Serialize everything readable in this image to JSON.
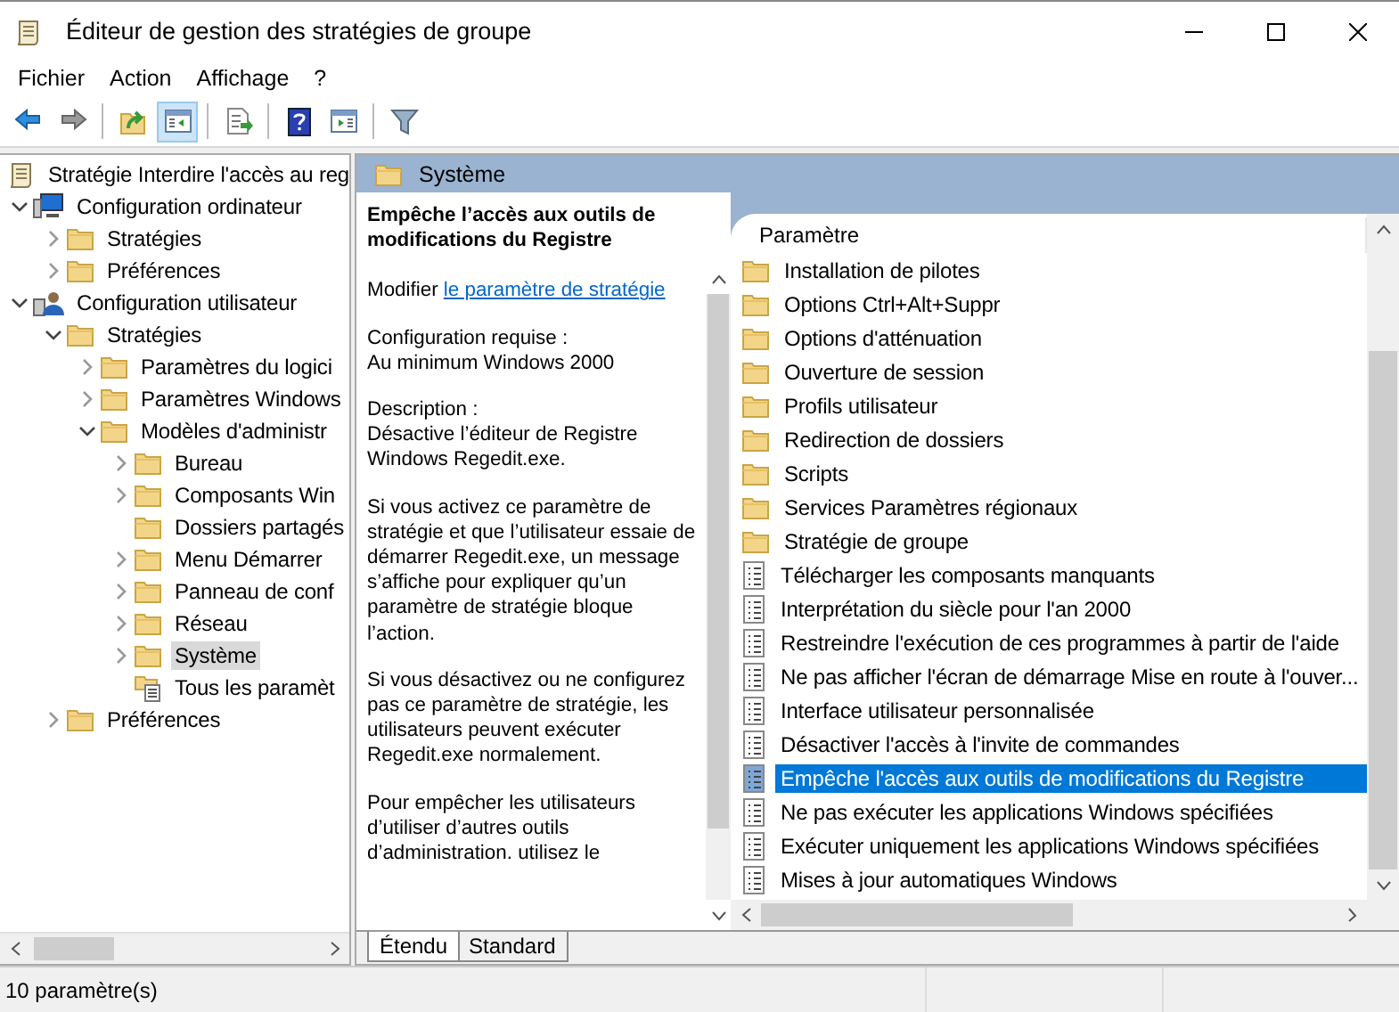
{
  "window": {
    "title": "Éditeur de gestion des stratégies de groupe"
  },
  "menu": [
    "Fichier",
    "Action",
    "Affichage",
    "?"
  ],
  "toolbar": [
    [
      {
        "kind": "back",
        "pressed": false
      },
      {
        "kind": "forward",
        "pressed": false
      }
    ],
    [
      {
        "kind": "up",
        "pressed": false
      },
      {
        "kind": "tree",
        "pressed": true
      }
    ],
    [
      {
        "kind": "export",
        "pressed": false
      }
    ],
    [
      {
        "kind": "help",
        "pressed": false
      },
      {
        "kind": "pane",
        "pressed": false
      }
    ],
    [
      {
        "kind": "filter",
        "pressed": false
      }
    ]
  ],
  "tree": [
    {
      "label": "Stratégie Interdire l'accès au reg",
      "kind": "policy",
      "selected": false,
      "children": [
        {
          "label": "Configuration ordinateur",
          "kind": "computer",
          "expanded": true,
          "selected": false,
          "children": [
            {
              "label": "Stratégies",
              "kind": "folder",
              "expanded": false,
              "selected": false
            },
            {
              "label": "Préférences",
              "kind": "folder",
              "expanded": false,
              "selected": false
            }
          ]
        },
        {
          "label": "Configuration utilisateur",
          "kind": "user",
          "expanded": true,
          "selected": false,
          "children": [
            {
              "label": "Stratégies",
              "kind": "folder",
              "expanded": true,
              "selected": false,
              "children": [
                {
                  "label": "Paramètres du logici",
                  "kind": "folder",
                  "expanded": false,
                  "selected": false
                },
                {
                  "label": "Paramètres Windows",
                  "kind": "folder",
                  "expanded": false,
                  "selected": false
                },
                {
                  "label": "Modèles d'administr",
                  "kind": "folder",
                  "expanded": true,
                  "selected": false,
                  "children": [
                    {
                      "label": "Bureau",
                      "kind": "folder",
                      "expanded": false,
                      "selected": false
                    },
                    {
                      "label": "Composants Win",
                      "kind": "folder",
                      "expanded": false,
                      "selected": false
                    },
                    {
                      "label": "Dossiers partagés",
                      "kind": "folder",
                      "selected": false
                    },
                    {
                      "label": "Menu Démarrer",
                      "kind": "folder",
                      "expanded": false,
                      "selected": false
                    },
                    {
                      "label": "Panneau de conf",
                      "kind": "folder",
                      "expanded": false,
                      "selected": false
                    },
                    {
                      "label": "Réseau",
                      "kind": "folder",
                      "expanded": false,
                      "selected": false
                    },
                    {
                      "label": "Système",
                      "kind": "folder",
                      "expanded": false,
                      "selected": true
                    },
                    {
                      "label": "Tous les paramèt",
                      "kind": "settings",
                      "selected": false
                    }
                  ]
                }
              ]
            },
            {
              "label": "Préférences",
              "kind": "folder",
              "expanded": false,
              "selected": false
            }
          ]
        }
      ]
    }
  ],
  "header": {
    "title": "Système"
  },
  "description": {
    "title": "Empêche l’accès aux outils de modifications du Registre",
    "edit_prefix": "Modifier",
    "edit_link": "le paramètre de stratégie",
    "sections": [
      {
        "label": "Configuration requise :",
        "text": "Au minimum Windows 2000"
      },
      {
        "label": "Description :",
        "text": "Désactive l’éditeur de Registre Windows Regedit.exe."
      }
    ],
    "paragraphs": [
      "Si vous activez ce paramètre de stratégie et que l’utilisateur essaie de démarrer Regedit.exe, un message s’affiche pour expliquer qu’un paramètre de stratégie bloque l’action.",
      "Si vous désactivez ou ne configurez pas ce paramètre de stratégie, les utilisateurs peuvent exécuter Regedit.exe normalement.",
      "Pour empêcher les utilisateurs d’utiliser d’autres outils d’administration. utilisez le"
    ]
  },
  "list": {
    "column": "Paramètre",
    "items": [
      {
        "label": "Installation de pilotes",
        "kind": "folder",
        "selected": false
      },
      {
        "label": "Options Ctrl+Alt+Suppr",
        "kind": "folder",
        "selected": false
      },
      {
        "label": "Options d'atténuation",
        "kind": "folder",
        "selected": false
      },
      {
        "label": "Ouverture de session",
        "kind": "folder",
        "selected": false
      },
      {
        "label": "Profils utilisateur",
        "kind": "folder",
        "selected": false
      },
      {
        "label": "Redirection de dossiers",
        "kind": "folder",
        "selected": false
      },
      {
        "label": "Scripts",
        "kind": "folder",
        "selected": false
      },
      {
        "label": "Services Paramètres régionaux",
        "kind": "folder",
        "selected": false
      },
      {
        "label": "Stratégie de groupe",
        "kind": "folder",
        "selected": false
      },
      {
        "label": "Télécharger les composants manquants",
        "kind": "setting",
        "selected": false
      },
      {
        "label": "Interprétation du siècle pour l'an 2000",
        "kind": "setting",
        "selected": false
      },
      {
        "label": "Restreindre l'exécution de ces programmes à partir de l'aide",
        "kind": "setting",
        "selected": false
      },
      {
        "label": "Ne pas afficher l'écran de démarrage Mise en route à l'ouver...",
        "kind": "setting",
        "selected": false
      },
      {
        "label": "Interface utilisateur personnalisée",
        "kind": "setting",
        "selected": false
      },
      {
        "label": "Désactiver l'accès à l'invite de commandes",
        "kind": "setting",
        "selected": false
      },
      {
        "label": "Empêche l'accès aux outils de modifications du Registre",
        "kind": "setting",
        "selected": true
      },
      {
        "label": "Ne pas exécuter les applications Windows spécifiées",
        "kind": "setting",
        "selected": false
      },
      {
        "label": "Exécuter uniquement les applications Windows spécifiées",
        "kind": "setting",
        "selected": false
      },
      {
        "label": "Mises à jour automatiques Windows",
        "kind": "setting",
        "selected": false
      }
    ]
  },
  "tabs": [
    {
      "label": "Étendu",
      "selected": true
    },
    {
      "label": "Standard",
      "selected": false
    }
  ],
  "status_bar": {
    "text": "10 paramètre(s)"
  }
}
